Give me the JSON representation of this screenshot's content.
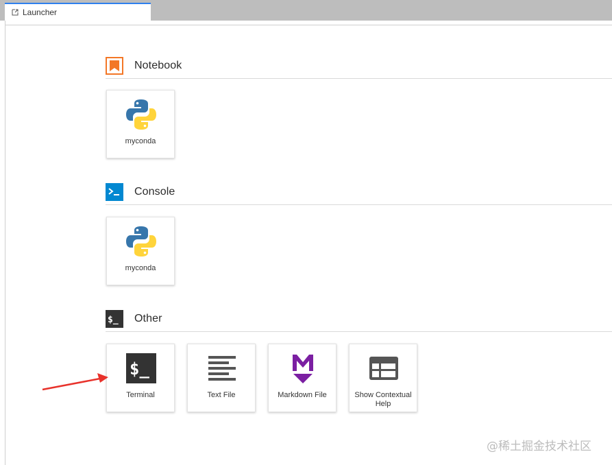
{
  "tab": {
    "title": "Launcher",
    "icon": "external-link-icon"
  },
  "sections": {
    "notebook": {
      "title": "Notebook",
      "icon": "bookmark-icon",
      "color": "#F37726"
    },
    "console": {
      "title": "Console",
      "icon": "console-prompt-icon",
      "color": "#0288D1"
    },
    "other": {
      "title": "Other",
      "icon": "terminal-dollar-icon",
      "color": "#333333"
    }
  },
  "cards": {
    "notebook_kernel": {
      "label": "myconda",
      "icon": "python-logo-icon"
    },
    "console_kernel": {
      "label": "myconda",
      "icon": "python-logo-icon"
    },
    "terminal": {
      "label": "Terminal",
      "icon": "terminal-icon"
    },
    "text_file": {
      "label": "Text File",
      "icon": "text-lines-icon"
    },
    "markdown_file": {
      "label": "Markdown File",
      "icon": "markdown-icon",
      "color": "#7B1FA2"
    },
    "contextual_help": {
      "label": "Show Contextual Help",
      "icon": "contextual-help-icon"
    }
  },
  "annotation": {
    "arrow_color": "#e8322b"
  },
  "watermark": "@稀土掘金技术社区"
}
